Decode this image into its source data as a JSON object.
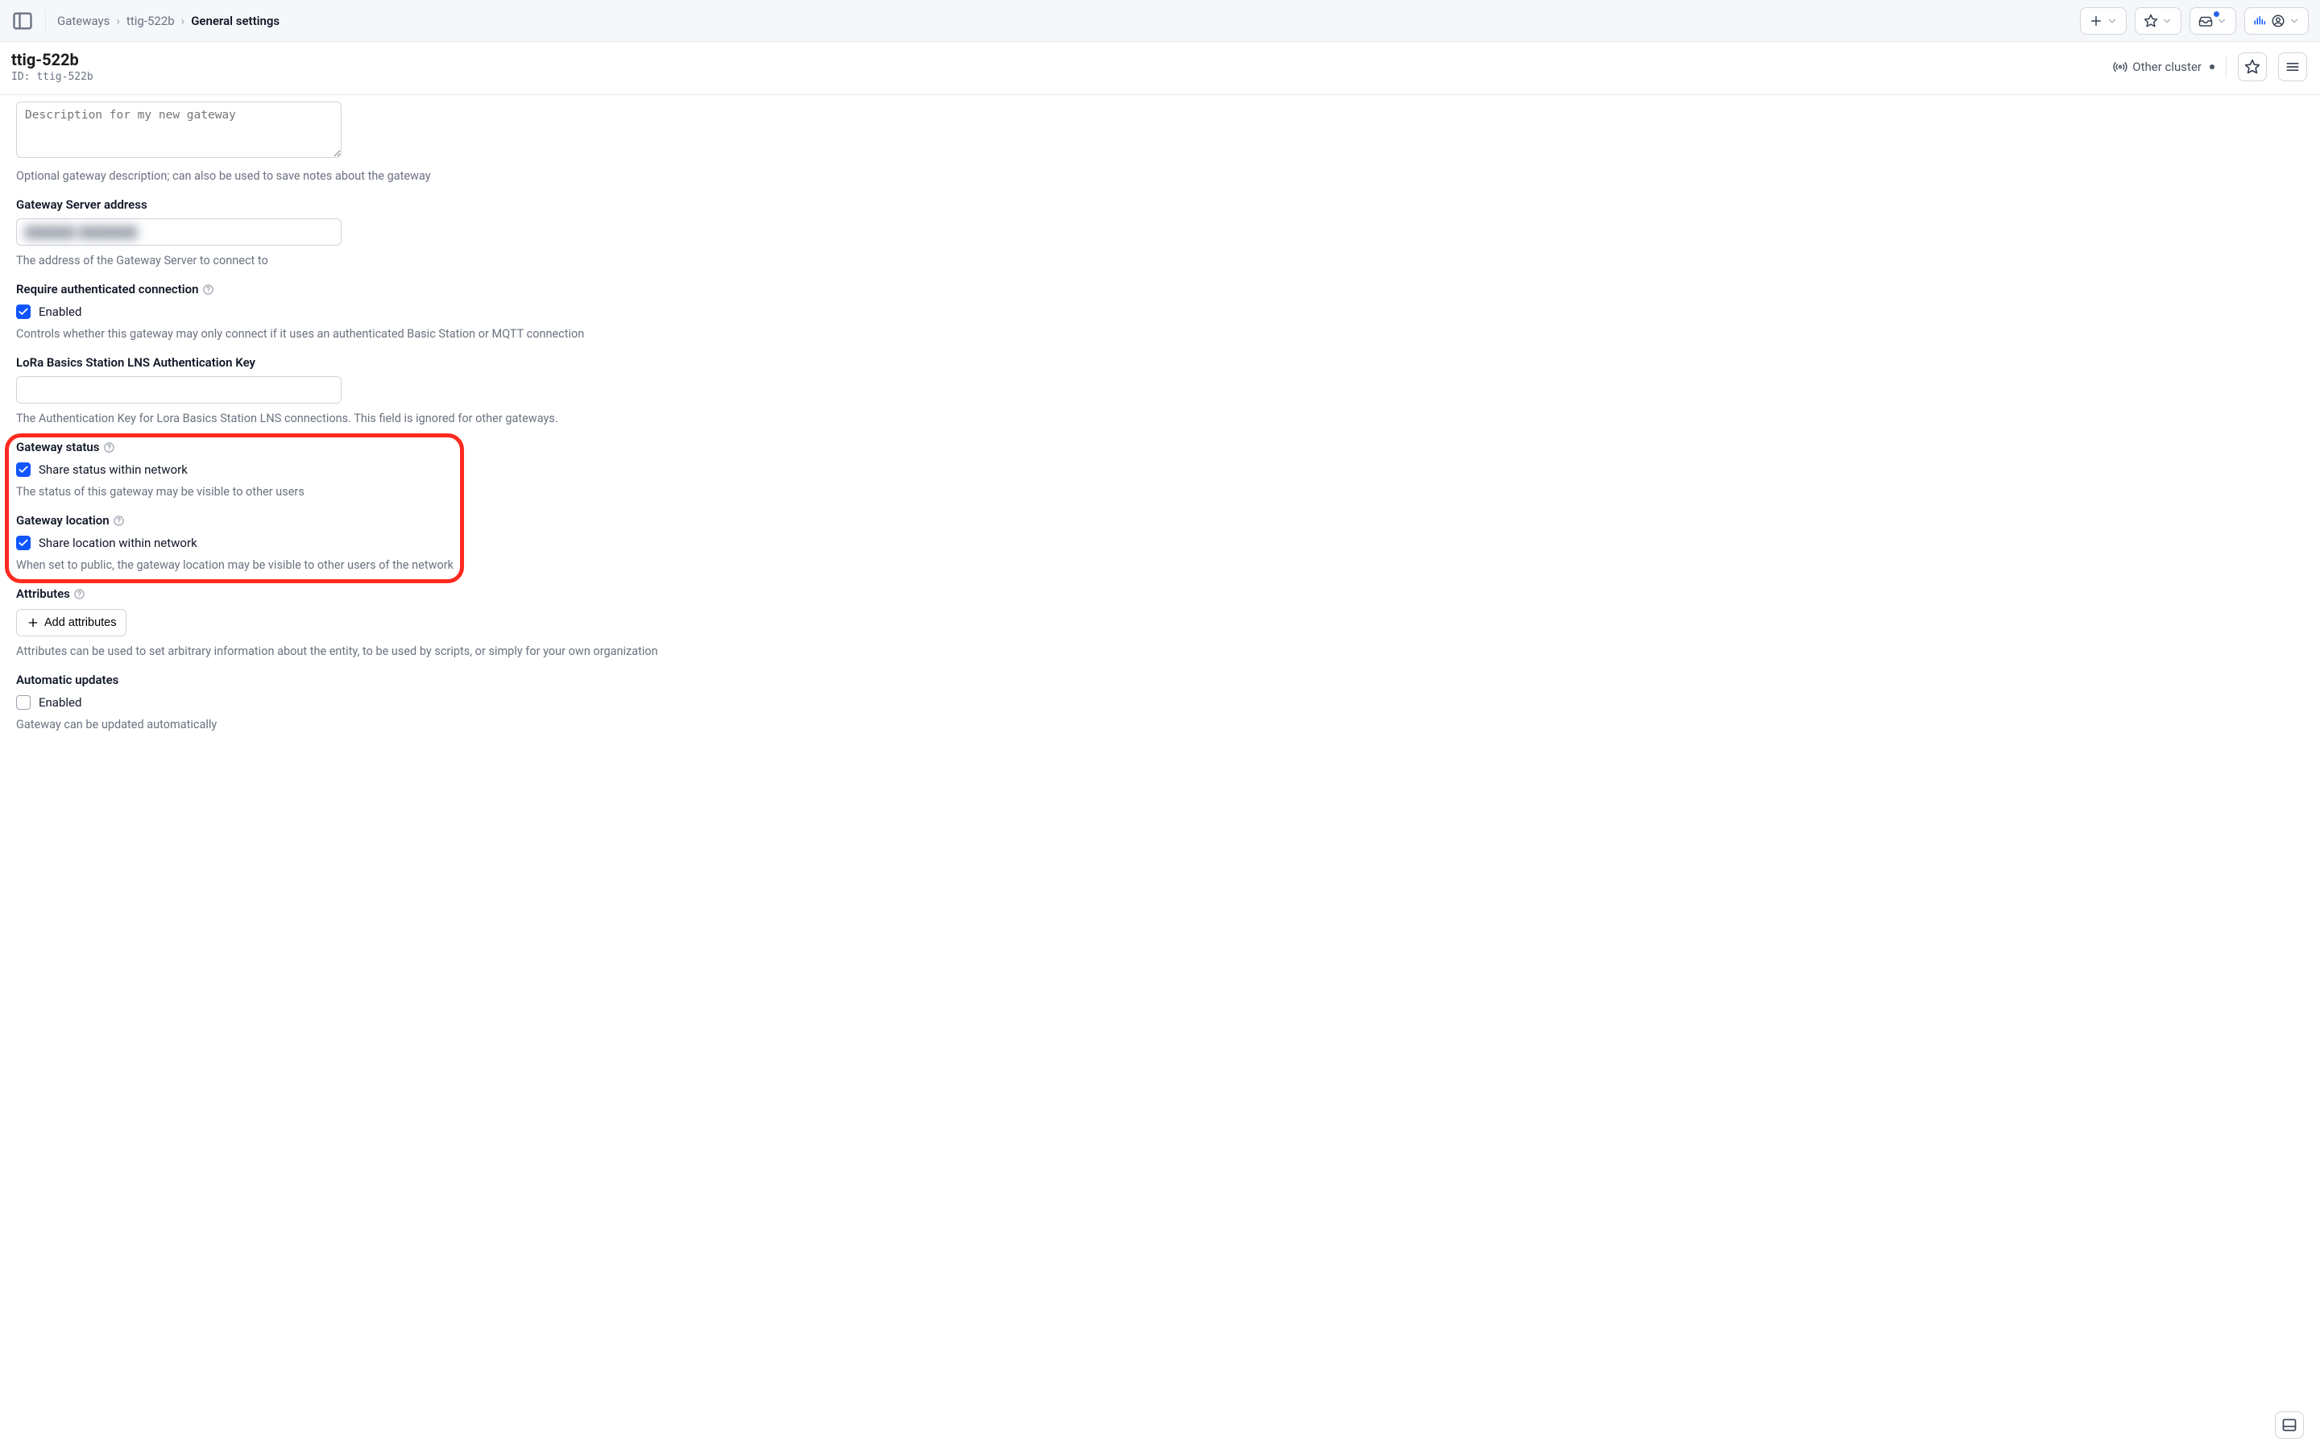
{
  "breadcrumb": {
    "root": "Gateways",
    "mid": "ttig-522b",
    "current": "General settings"
  },
  "header": {
    "title": "ttig-522b",
    "id_label": "ID: ",
    "id_value": "ttig-522b",
    "cluster_text": "Other cluster"
  },
  "form": {
    "description": {
      "placeholder": "Description for my new gateway",
      "value": "",
      "hint": "Optional gateway description; can also be used to save notes about the gateway"
    },
    "gsa": {
      "label": "Gateway Server address",
      "value": "",
      "masked_display": "██████ ███████",
      "hint": "The address of the Gateway Server to connect to"
    },
    "auth_conn": {
      "label": "Require authenticated connection",
      "checkbox_label": "Enabled",
      "checked": true,
      "hint": "Controls whether this gateway may only connect if it uses an authenticated Basic Station or MQTT connection"
    },
    "lns_key": {
      "label": "LoRa Basics Station LNS Authentication Key",
      "value": "",
      "hint": "The Authentication Key for Lora Basics Station LNS connections. This field is ignored for other gateways."
    },
    "gw_status": {
      "label": "Gateway status",
      "checkbox_label": "Share status within network",
      "checked": true,
      "hint": "The status of this gateway may be visible to other users"
    },
    "gw_location": {
      "label": "Gateway location",
      "checkbox_label": "Share location within network",
      "checked": true,
      "hint": "When set to public, the gateway location may be visible to other users of the network"
    },
    "attributes": {
      "label": "Attributes",
      "button": "Add attributes",
      "hint": "Attributes can be used to set arbitrary information about the entity, to be used by scripts, or simply for your own organization"
    },
    "auto_updates": {
      "label": "Automatic updates",
      "checkbox_label": "Enabled",
      "checked": false,
      "hint": "Gateway can be updated automatically"
    }
  }
}
